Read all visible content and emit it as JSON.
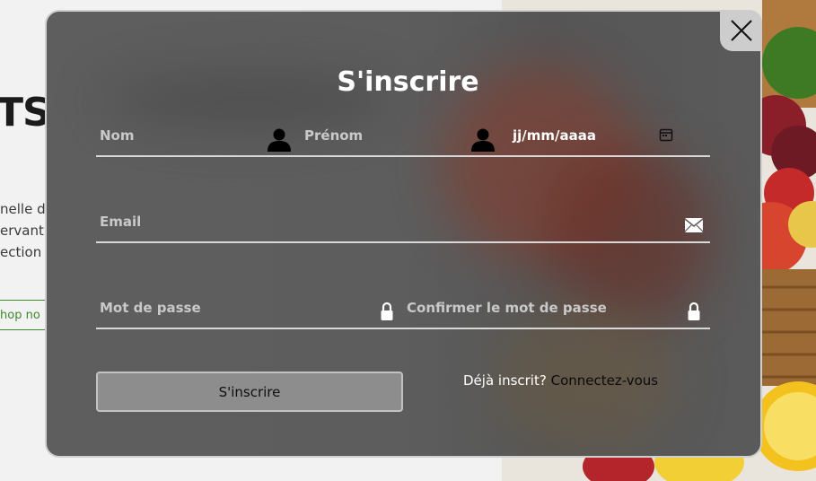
{
  "background": {
    "heading_fragment": "TS c",
    "lines": [
      "nelle d",
      "ervant",
      "ection d"
    ],
    "shop_button": "hop no"
  },
  "modal": {
    "title": "S'inscrire",
    "fields": {
      "last_name_placeholder": "Nom",
      "first_name_placeholder": "Prénom",
      "date_placeholder": "jj/mm/aaaa",
      "email_placeholder": "Email",
      "password_placeholder": "Mot de passe",
      "confirm_password_placeholder": "Confirmer le mot de passe"
    },
    "submit_label": "S'inscrire",
    "login_prompt": "Déjà inscrit?",
    "login_link": "Connectez-vous"
  },
  "icons": [
    "close-icon",
    "user-icon",
    "calendar-icon",
    "envelope-icon",
    "lock-icon"
  ]
}
